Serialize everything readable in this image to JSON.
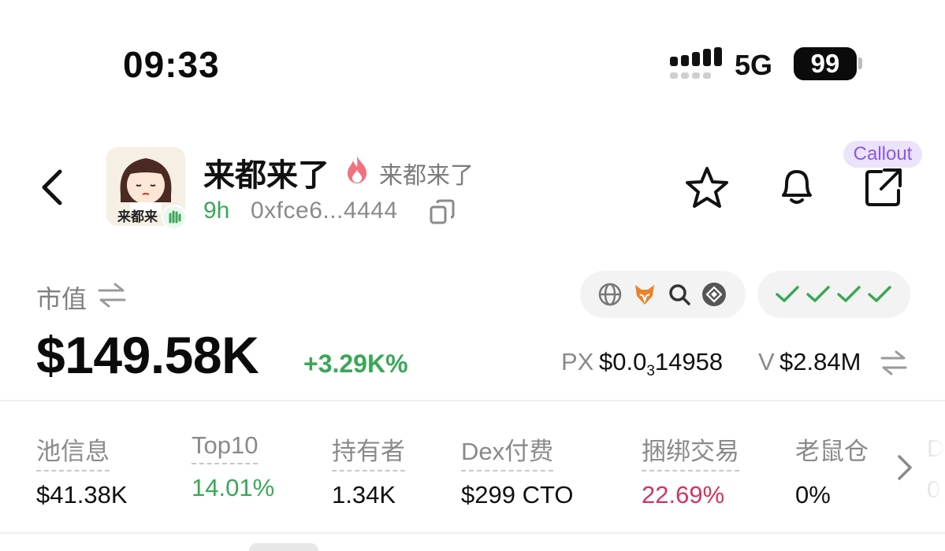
{
  "status_bar": {
    "time": "09:33",
    "network": "5G",
    "battery": "99",
    "icons": [
      "signal-bars-icon",
      "battery-icon"
    ]
  },
  "header": {
    "icons": [
      "back-chevron-icon",
      "flame-icon",
      "copy-icon",
      "star-icon",
      "bell-icon",
      "share-icon"
    ],
    "avatar_caption": "来都来",
    "token_name": "来都来了",
    "token_subtitle": "来都来了",
    "age": "9h",
    "address": "0xfce6...4444",
    "callout_label": "Callout"
  },
  "market": {
    "label": "市值",
    "value": "$149.58K",
    "change": "+3.29K%",
    "px_label": "PX",
    "px_value_prefix": "$0.0",
    "px_value_sub": "3",
    "px_value_suffix": "14958",
    "v_label": "V",
    "v_value": "$2.84M",
    "link_icons": [
      "globe-icon",
      "fox-icon",
      "search-icon",
      "bnb-chain-icon"
    ],
    "checks": [
      "check-icon",
      "check-icon",
      "check-icon",
      "check-icon"
    ]
  },
  "stats": [
    {
      "label": "池信息",
      "value": "$41.38K",
      "tone": "default"
    },
    {
      "label": "Top10",
      "value": "14.01%",
      "tone": "green"
    },
    {
      "label": "持有者",
      "value": "1.34K",
      "tone": "default"
    },
    {
      "label": "Dex付费",
      "value": "$299 CTO",
      "tone": "default"
    },
    {
      "label": "捆绑交易",
      "value": "22.69%",
      "tone": "red"
    },
    {
      "label": "老鼠仓",
      "value": "0%",
      "tone": "default"
    }
  ],
  "stats_overflow": {
    "label": "D",
    "value": "0"
  },
  "colors": {
    "accent_green": "#3aa757",
    "accent_red": "#d6335c",
    "callout_bg": "#ebe2fb",
    "callout_text": "#8a59e8",
    "muted": "#8a8a8a"
  }
}
